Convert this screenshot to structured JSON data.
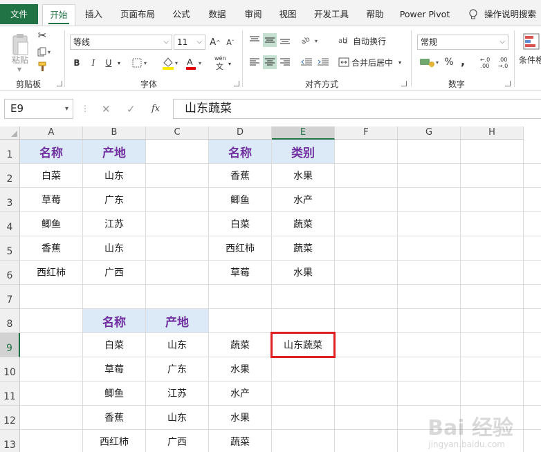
{
  "ribbon_tabs": [
    "文件",
    "开始",
    "插入",
    "页面布局",
    "公式",
    "数据",
    "审阅",
    "视图",
    "开发工具",
    "帮助",
    "Power Pivot",
    "操作说明搜索"
  ],
  "active_tab": "开始",
  "clipboard": {
    "paste_label": "粘贴",
    "group_label": "剪贴板"
  },
  "font": {
    "name": "等线",
    "size": "11",
    "bold": "B",
    "italic": "I",
    "underline": "U",
    "group_label": "字体",
    "grow": "A",
    "shrink": "A",
    "phonetic": "wén"
  },
  "alignment": {
    "wrap_text": "自动换行",
    "merge_center": "合并后居中",
    "group_label": "对齐方式"
  },
  "number": {
    "format": "常规",
    "percent": "%",
    "comma": ",",
    "inc_decimal": "←.0 .00",
    "dec_decimal": ".00 →.0",
    "group_label": "数字"
  },
  "styles": {
    "conditional_format": "条件格"
  },
  "formula_bar": {
    "name_box": "E9",
    "fx": "fx",
    "content": "山东蔬菜"
  },
  "columns": [
    "A",
    "B",
    "C",
    "D",
    "E",
    "F",
    "G",
    "H"
  ],
  "rows": [
    "1",
    "2",
    "3",
    "4",
    "5",
    "6",
    "7",
    "8",
    "9",
    "10",
    "11",
    "12",
    "13"
  ],
  "selected_cell": "E9",
  "cells": {
    "A1": "名称",
    "B1": "产地",
    "D1": "名称",
    "E1": "类别",
    "A2": "白菜",
    "B2": "山东",
    "D2": "香蕉",
    "E2": "水果",
    "A3": "草莓",
    "B3": "广东",
    "D3": "鲫鱼",
    "E3": "水产",
    "A4": "鲫鱼",
    "B4": "江苏",
    "D4": "白菜",
    "E4": "蔬菜",
    "A5": "香蕉",
    "B5": "山东",
    "D5": "西红柿",
    "E5": "蔬菜",
    "A6": "西红柿",
    "B6": "广西",
    "D6": "草莓",
    "E6": "水果",
    "B8": "名称",
    "C8": "产地",
    "B9": "白菜",
    "C9": "山东",
    "D9": "蔬菜",
    "E9": "山东蔬菜",
    "B10": "草莓",
    "C10": "广东",
    "D10": "水果",
    "B11": "鲫鱼",
    "C11": "江苏",
    "D11": "水产",
    "B12": "香蕉",
    "C12": "山东",
    "D12": "水果",
    "B13": "西红柿",
    "C13": "广西",
    "D13": "蔬菜"
  },
  "header_cells": [
    "A1",
    "B1",
    "D1",
    "E1",
    "B8",
    "C8"
  ],
  "watermark": {
    "brand": "Bai 经验",
    "url": "jingyan.baidu.com"
  },
  "colors": {
    "excel_green": "#217346",
    "header_fill": "#dce9f6",
    "header_text": "#7030a0",
    "highlight_border": "#e02020"
  }
}
